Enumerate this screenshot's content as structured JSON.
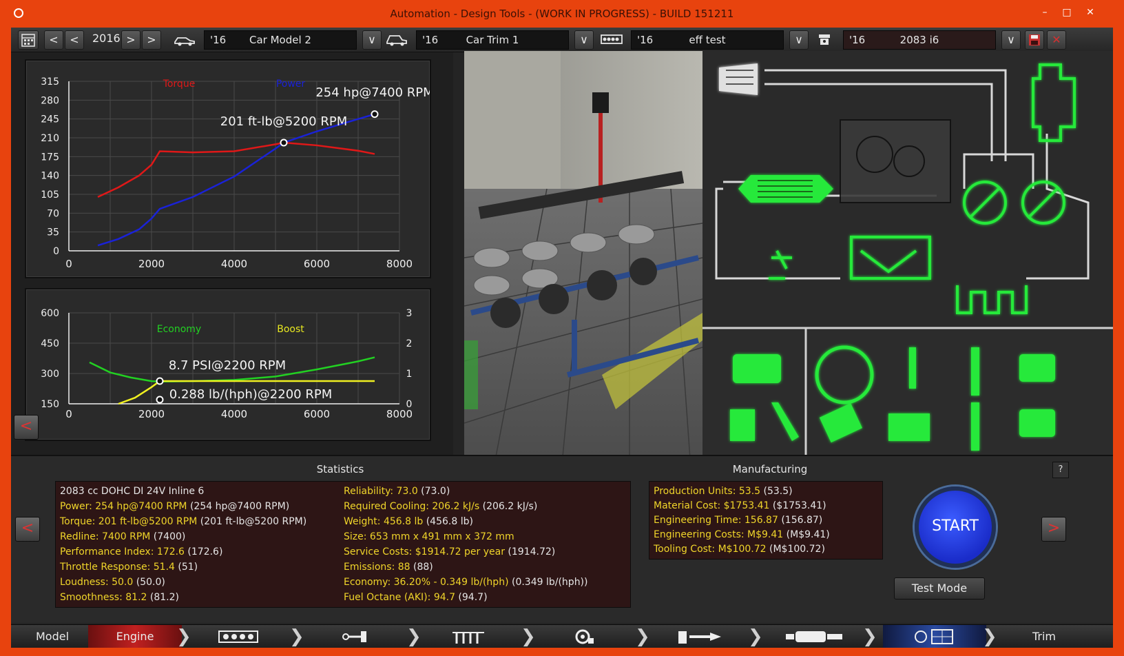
{
  "window": {
    "title": "Automation - Design Tools - (WORK IN PROGRESS) - BUILD 151211",
    "min_label": "–",
    "max_label": "□",
    "close_label": "✕"
  },
  "toolbar": {
    "year": "2016",
    "prev_label": "<",
    "prev2_label": "<",
    "next_label": ">",
    "next2_label": ">",
    "car_model": {
      "year": "'16",
      "name": "Car Model 2"
    },
    "car_trim": {
      "year": "'16",
      "name": "Car Trim 1"
    },
    "engine_family": {
      "year": "'16",
      "name": "eff test"
    },
    "engine_variant": {
      "year": "'16",
      "name": "2083 i6"
    },
    "dropdown_label": "∨",
    "close_label": "✕"
  },
  "chart_data": [
    {
      "type": "line",
      "title": "",
      "x_ticks": [
        "0",
        "2000",
        "4000",
        "6000",
        "8000"
      ],
      "y_ticks": [
        "0",
        "35",
        "70",
        "105",
        "140",
        "175",
        "210",
        "245",
        "280",
        "315"
      ],
      "xlim": [
        0,
        8000
      ],
      "ylim": [
        0,
        315
      ],
      "legend": [
        "Torque",
        "Power"
      ],
      "series": [
        {
          "name": "Torque",
          "color": "#e01818",
          "x": [
            700,
            1200,
            1700,
            2000,
            2200,
            3000,
            4000,
            5000,
            5200,
            6000,
            7000,
            7400
          ],
          "y": [
            100,
            118,
            140,
            160,
            185,
            183,
            185,
            198,
            201,
            196,
            186,
            180
          ]
        },
        {
          "name": "Power",
          "color": "#1a22d8",
          "x": [
            700,
            1200,
            1700,
            2000,
            2200,
            3000,
            4000,
            5000,
            5200,
            6000,
            7000,
            7400
          ],
          "y": [
            10,
            22,
            40,
            60,
            78,
            100,
            138,
            190,
            201,
            222,
            245,
            254
          ]
        }
      ],
      "annotations": [
        "254 hp@7400 RPM",
        "201 ft-lb@5200 RPM"
      ],
      "grid": true
    },
    {
      "type": "line",
      "x_ticks": [
        "0",
        "2000",
        "4000",
        "6000",
        "8000"
      ],
      "y_ticks_left": [
        "150",
        "300",
        "450",
        "600"
      ],
      "y_ticks_right": [
        "0",
        "1",
        "2",
        "3"
      ],
      "xlim": [
        0,
        8000
      ],
      "ylim_left": [
        150,
        600
      ],
      "ylim_right": [
        0,
        3
      ],
      "legend": [
        "Economy",
        "Boost"
      ],
      "series": [
        {
          "name": "Economy",
          "color": "#22d122",
          "axis": "left",
          "x": [
            500,
            1000,
            1500,
            2000,
            2200,
            3000,
            4000,
            5000,
            6000,
            7000,
            7400
          ],
          "y": [
            355,
            305,
            280,
            262,
            260,
            262,
            268,
            285,
            320,
            360,
            380
          ]
        },
        {
          "name": "Boost",
          "color": "#f0f020",
          "axis": "right",
          "x": [
            1200,
            1600,
            2000,
            2200,
            3000,
            4000,
            5000,
            6000,
            7000,
            7400
          ],
          "y": [
            0,
            0.2,
            0.55,
            0.75,
            0.75,
            0.75,
            0.75,
            0.75,
            0.75,
            0.75
          ]
        }
      ],
      "annotations": [
        "8.7 PSI@2200 RPM",
        "0.288 lb/(hph)@2200 RPM"
      ],
      "grid": true
    }
  ],
  "statistics": {
    "header": "Statistics",
    "col1": [
      {
        "k": "2083 cc DOHC DI 24V Inline 6",
        "v": ""
      },
      {
        "k": "Power: 254 hp@7400 RPM",
        "v": " (254 hp@7400 RPM)"
      },
      {
        "k": "Torque: 201 ft-lb@5200 RPM",
        "v": " (201 ft-lb@5200 RPM)"
      },
      {
        "k": "Redline: 7400 RPM",
        "v": " (7400)"
      },
      {
        "k": "Performance Index: 172.6",
        "v": " (172.6)"
      },
      {
        "k": "Throttle Response: 51.4",
        "v": " (51)"
      },
      {
        "k": "Loudness: 50.0",
        "v": " (50.0)"
      },
      {
        "k": "Smoothness: 81.2",
        "v": " (81.2)"
      }
    ],
    "col2": [
      {
        "k": "Reliability: 73.0",
        "v": " (73.0)"
      },
      {
        "k": "Required Cooling: 206.2 kJ/s",
        "v": " (206.2 kJ/s)"
      },
      {
        "k": "Weight: 456.8 lb",
        "v": " (456.8 lb)"
      },
      {
        "k": "Size: 653 mm x 491 mm x 372 mm",
        "v": ""
      },
      {
        "k": "Service Costs: $1914.72 per year",
        "v": " (1914.72)"
      },
      {
        "k": "Emissions: 88",
        "v": " (88)"
      },
      {
        "k": "Economy: 36.20% - 0.349 lb/(hph)",
        "v": " (0.349 lb/(hph))"
      },
      {
        "k": "Fuel Octane (AKI): 94.7",
        "v": " (94.7)"
      }
    ]
  },
  "manufacturing": {
    "header": "Manufacturing",
    "rows": [
      {
        "k": "Production Units: 53.5",
        "v": " (53.5)"
      },
      {
        "k": "Material Cost: $1753.41",
        "v": " ($1753.41)"
      },
      {
        "k": "Engineering Time: 156.87",
        "v": " (156.87)"
      },
      {
        "k": "Engineering Costs: M$9.41",
        "v": " (M$9.41)"
      },
      {
        "k": "Tooling Cost: M$100.72",
        "v": " (M$100.72)"
      }
    ]
  },
  "actions": {
    "start_label": "START",
    "test_mode_label": "Test Mode",
    "help_label": "?",
    "back_label": "<",
    "forward_label": ">"
  },
  "nav": {
    "model_label": "Model",
    "engine_label": "Engine",
    "trim_label": "Trim",
    "icons": [
      "engine-block-icon",
      "crank-icon",
      "valvetrain-icon",
      "turbo-icon",
      "fuel-icon",
      "exhaust-icon",
      "tune-icon"
    ]
  },
  "colors": {
    "accent": "#e8430e",
    "label_yellow": "#f0d52a",
    "diagram_green": "#27e93a",
    "start_blue": "#2a45e8"
  }
}
